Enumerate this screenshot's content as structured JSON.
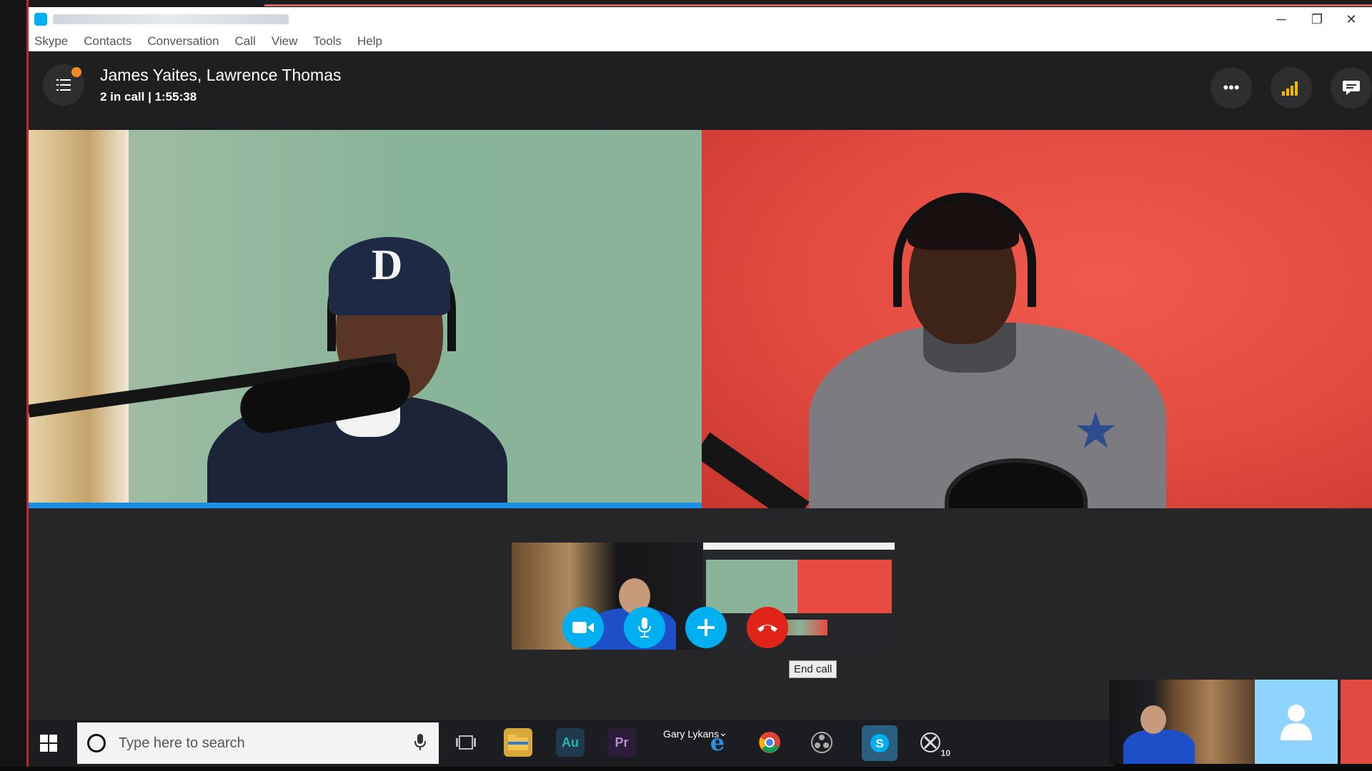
{
  "window": {
    "controls": {
      "minimize": "─",
      "maximize": "❐",
      "close": "✕"
    }
  },
  "menubar": {
    "items": [
      "Skype",
      "Contacts",
      "Conversation",
      "Call",
      "View",
      "Tools",
      "Help"
    ]
  },
  "call": {
    "title": "James Yaites, Lawrence Thomas",
    "status": "2 in call | 1:55:38",
    "participants": [
      "James Yaites",
      "Lawrence Thomas"
    ],
    "header_buttons": {
      "more": "more-icon",
      "signal": "signal-icon",
      "chat": "chat-icon"
    },
    "unread_dot_color": "#f48a21"
  },
  "controls": {
    "video": "video-camera-icon",
    "mic": "microphone-icon",
    "add": "plus-icon",
    "end": "end-call-icon",
    "end_tooltip": "End call",
    "accent": "#00aff0",
    "end_color": "#e2231a"
  },
  "taskbar": {
    "search_placeholder": "Type here to search",
    "user_label": "Gary Lykans",
    "apps": {
      "audition": "Au",
      "premiere": "Pr",
      "xbox_badge": "10"
    }
  }
}
